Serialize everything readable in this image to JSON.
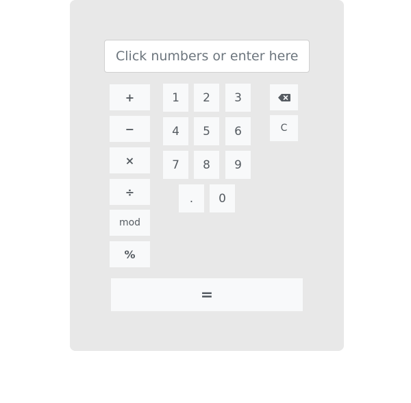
{
  "display": {
    "placeholder": "Click numbers or enter here..."
  },
  "operators": {
    "add": "+",
    "subtract": "−",
    "multiply": "×",
    "divide": "÷",
    "mod": "mod",
    "percent": "%"
  },
  "digits": {
    "d1": "1",
    "d2": "2",
    "d3": "3",
    "d4": "4",
    "d5": "5",
    "d6": "6",
    "d7": "7",
    "d8": "8",
    "d9": "9",
    "dot": ".",
    "d0": "0"
  },
  "controls": {
    "backspace_icon": "backspace-icon",
    "clear": "C",
    "equals": "="
  },
  "colors": {
    "panel": "#e8e8e8",
    "button": "#f8f9fa",
    "button_text": "#555b61"
  }
}
